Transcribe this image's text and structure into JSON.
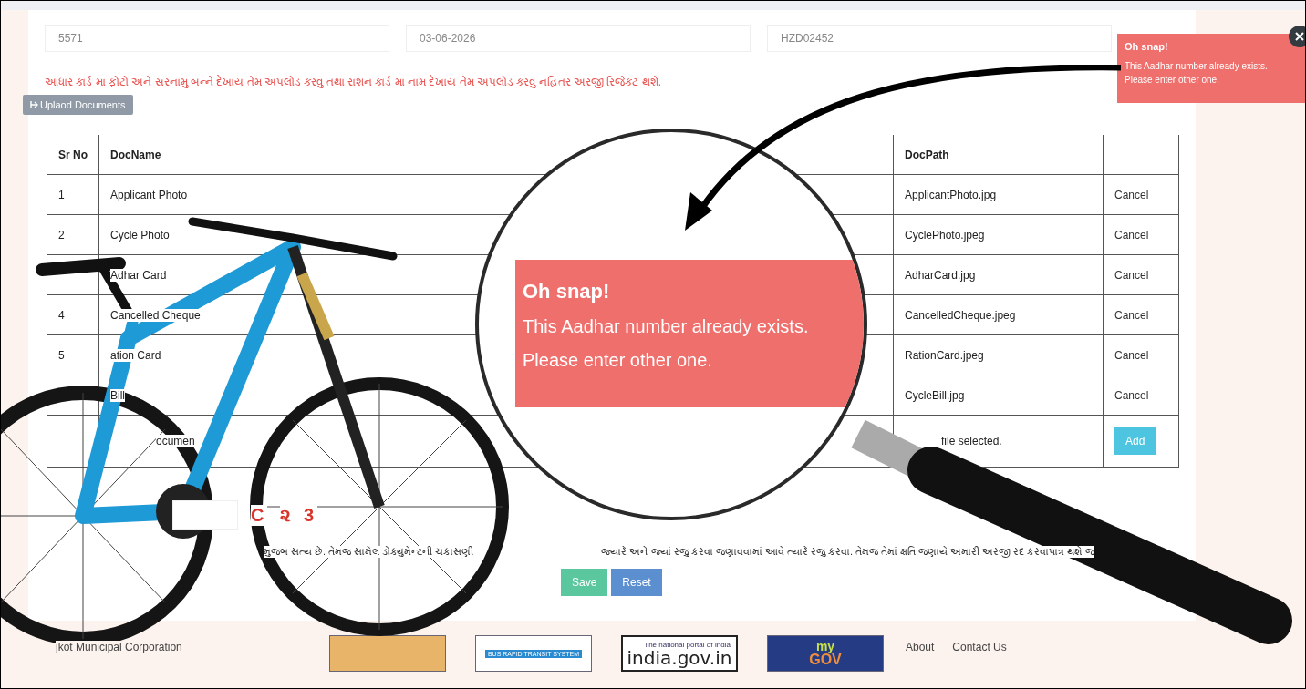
{
  "fields": [
    {
      "value": "5571"
    },
    {
      "value": "03-06-2026"
    },
    {
      "value": "HZD02452"
    }
  ],
  "notice": "આધાર કાર્ડ મા ફોટો અને સરનામું બન્ને દેખાય તેમ અપલોડ કરવું તથા રાશન કાર્ડ મા નામ દેખાય તેમ અપલોડ કરવું નહિતર અરજી રિજેક્ટ થશે.",
  "section_tab": {
    "label": "Uplaod Documents"
  },
  "table": {
    "columns": [
      "Sr No",
      "DocName",
      "DocPath"
    ],
    "rows": [
      {
        "sr_no": "1",
        "doc_name": "Applicant Photo",
        "doc_path": "ApplicantPhoto.jpg",
        "action": "Cancel"
      },
      {
        "sr_no": "2",
        "doc_name": "Cycle Photo",
        "doc_path": "CyclePhoto.jpeg",
        "action": "Cancel"
      },
      {
        "doc_name": "Adhar Card",
        "doc_path": "AdharCard.jpg",
        "action": "Cancel"
      },
      {
        "sr_no": "4",
        "doc_name": "Cancelled Cheque",
        "doc_path": "CancelledCheque.jpeg",
        "action": "Cancel"
      },
      {
        "sr_no": "5",
        "doc_name": "ation Card",
        "doc_path": "RationCard.jpeg",
        "action": "Cancel"
      },
      {
        "doc_name": "Bill",
        "doc_path": "CycleBill.jpg",
        "action": "Cancel"
      }
    ],
    "upload_row": {
      "doc_name": "ocumen",
      "file_status": "file selected.",
      "button": "Add"
    }
  },
  "captcha": {
    "parts": [
      "C",
      "૨ 3"
    ]
  },
  "declaration": [
    "મુજબ સત્ય છે. તેમજ સામેલ ડોક્યુમેન્ટની ચકાસણી",
    "જ્યારે અને જ્યાં રજુ કરવા જણાવવામાં આવે ત્યારે રજુ કરવા. તેમજ તેમાં ક્ષતિ જણાયે અમારી અરજી રદ કરવાપાત્ર થશે જ"
  ],
  "buttons": [
    {
      "label": "Save",
      "kind": "save"
    },
    {
      "label": "Reset",
      "kind": "reset"
    }
  ],
  "toast": {
    "title": "Oh snap!",
    "lines": [
      "This Aadhar number already exists.",
      "Please enter other one."
    ]
  },
  "magnifier": {
    "title": "Oh snap!",
    "lines": [
      "This Aadhar number already exists.",
      "Please enter other one."
    ]
  },
  "footer": {
    "org": "jkot Municipal Corporation",
    "logos": [
      {
        "kind": "emblem"
      },
      {
        "kind": "brts",
        "text": "BUS RAPID TRANSIT SYSTEM"
      },
      {
        "kind": "india",
        "text": "india.gov.in",
        "tagline": "The national portal of India"
      },
      {
        "kind": "mygov",
        "text": "my",
        "text2": "GOV"
      }
    ],
    "links": [
      "About",
      "Contact Us"
    ]
  }
}
